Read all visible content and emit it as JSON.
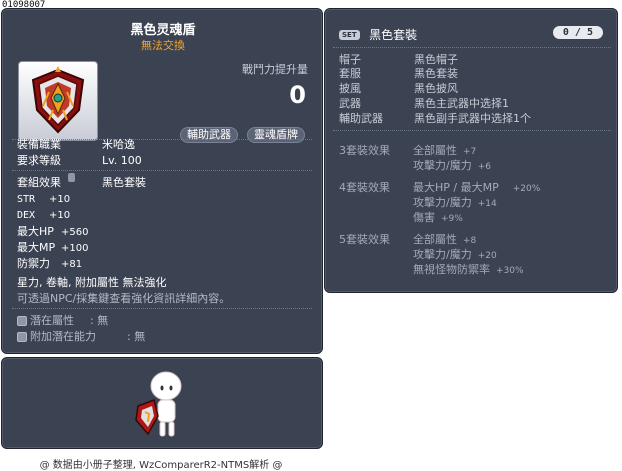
{
  "item": {
    "id": "01098007",
    "name": "黑色灵魂盾",
    "trade": "無法交換",
    "power_label": "戰鬥力提升量",
    "power_value": "0",
    "tags": [
      "輔助武器",
      "靈魂盾牌"
    ],
    "job_label": "裝備職業",
    "job_value": "米哈逸",
    "level_label": "要求等級",
    "level_value": "Lv. 100",
    "set_label": "套組效果",
    "set_value": "黑色套裝",
    "stats": [
      {
        "k": "STR",
        "v": "+10"
      },
      {
        "k": "DEX",
        "v": "+10"
      },
      {
        "k": "最大HP",
        "v": "+560"
      },
      {
        "k": "最大MP",
        "v": "+100"
      },
      {
        "k": "防禦力",
        "v": "+81"
      }
    ],
    "flags": "星力, 卷軸, 附加屬性 無法強化",
    "hint": "可透過NPC/採集鍵查看強化資訊詳細內容。",
    "potential_label": "潛在屬性",
    "potential_value": ": 無",
    "add_potential_label": "附加潛在能力",
    "add_potential_value": ": 無"
  },
  "set": {
    "badge": "SET",
    "name": "黑色套裝",
    "count": "0 / 5",
    "pieces": [
      {
        "k": "帽子",
        "v": "黑色帽子"
      },
      {
        "k": "套服",
        "v": "黑色套装"
      },
      {
        "k": "披風",
        "v": "黑色披风"
      },
      {
        "k": "武器",
        "v": "黑色主武器中选择1"
      },
      {
        "k": "輔助武器",
        "v": "黑色副手武器中选择1个"
      }
    ],
    "effects": [
      {
        "label": "3套裝效果",
        "lines": [
          {
            "t": "全部屬性",
            "v": "+7"
          },
          {
            "t": "攻擊力/魔力",
            "v": "+6"
          }
        ]
      },
      {
        "label": "4套裝效果",
        "lines": [
          {
            "t": "最大HP / 最大MP",
            "v": "+20%"
          },
          {
            "t": "攻擊力/魔力",
            "v": "+14"
          },
          {
            "t": "傷害",
            "v": "+9%"
          }
        ]
      },
      {
        "label": "5套裝效果",
        "lines": [
          {
            "t": "全部屬性",
            "v": "+8"
          },
          {
            "t": "攻擊力/魔力",
            "v": "+20"
          },
          {
            "t": "無視怪物防禦率",
            "v": "+30%"
          }
        ]
      }
    ]
  },
  "footer": "@ 数据由小册子整理, WzComparerR2-NTMS解析 @"
}
